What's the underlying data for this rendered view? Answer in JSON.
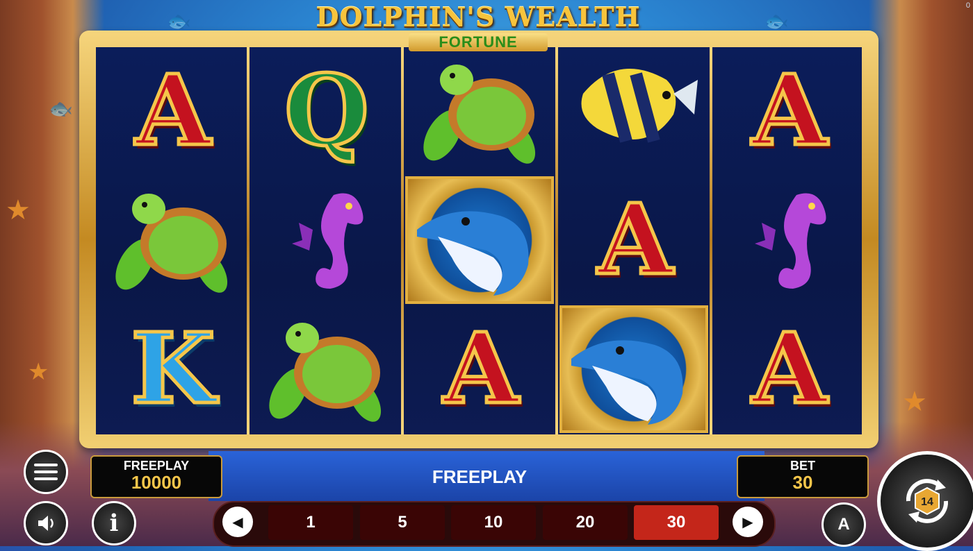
{
  "game": {
    "title": "DOLPHIN'S WEALTH",
    "subtitle": "FORTUNE"
  },
  "reels": [
    [
      "A",
      "turtle",
      "K"
    ],
    [
      "Q",
      "seahorse",
      "turtle"
    ],
    [
      "turtle",
      "dolphin",
      "A"
    ],
    [
      "fish",
      "A",
      "dolphin"
    ],
    [
      "A",
      "seahorse",
      "A"
    ]
  ],
  "balance": {
    "label": "FREEPLAY",
    "value": "10000"
  },
  "status": {
    "text": "FREEPLAY"
  },
  "bet": {
    "label": "BET",
    "value": "30"
  },
  "bet_options": [
    "1",
    "5",
    "10",
    "20",
    "30"
  ],
  "selected_bet": "30",
  "corner_counter": "0",
  "spin_icon_digits": "14",
  "auto_label": "A",
  "colors": {
    "accent_gold": "#f6c64a",
    "bet_active": "#c4261a",
    "bar_blue": "#2a63d8"
  }
}
